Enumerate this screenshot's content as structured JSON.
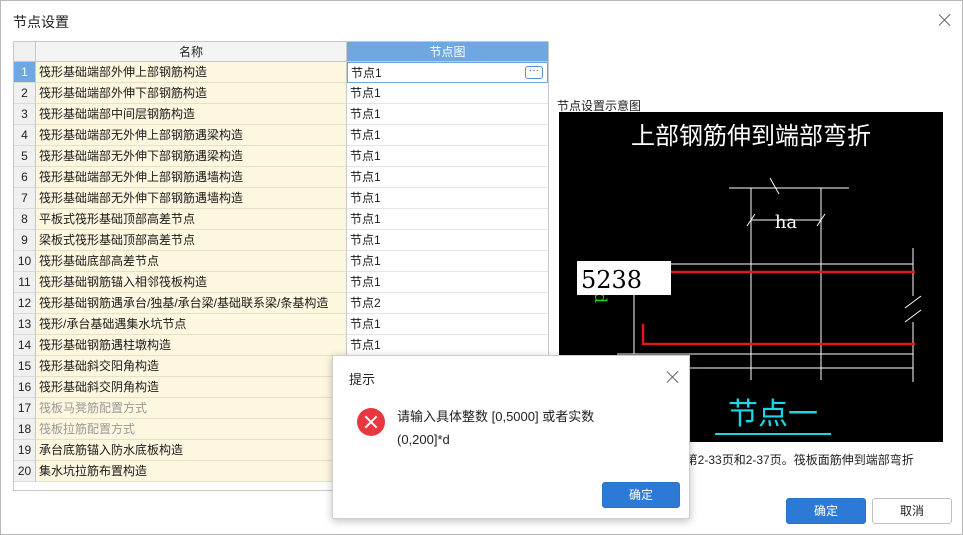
{
  "window": {
    "title": "节点设置"
  },
  "table": {
    "headers": {
      "name": "名称",
      "node": "节点图"
    },
    "rows": [
      {
        "num": "1",
        "name": "筏形基础端部外伸上部钢筋构造",
        "node": "节点1"
      },
      {
        "num": "2",
        "name": "筏形基础端部外伸下部钢筋构造",
        "node": "节点1"
      },
      {
        "num": "3",
        "name": "筏形基础端部中间层钢筋构造",
        "node": "节点1"
      },
      {
        "num": "4",
        "name": "筏形基础端部无外伸上部钢筋遇梁构造",
        "node": "节点1"
      },
      {
        "num": "5",
        "name": "筏形基础端部无外伸下部钢筋遇梁构造",
        "node": "节点1"
      },
      {
        "num": "6",
        "name": "筏形基础端部无外伸上部钢筋遇墙构造",
        "node": "节点1"
      },
      {
        "num": "7",
        "name": "筏形基础端部无外伸下部钢筋遇墙构造",
        "node": "节点1"
      },
      {
        "num": "8",
        "name": "平板式筏形基础顶部高差节点",
        "node": "节点1"
      },
      {
        "num": "9",
        "name": "梁板式筏形基础顶部高差节点",
        "node": "节点1"
      },
      {
        "num": "10",
        "name": "筏形基础底部高差节点",
        "node": "节点1"
      },
      {
        "num": "11",
        "name": "筏形基础钢筋锚入相邻筏板构造",
        "node": "节点1"
      },
      {
        "num": "12",
        "name": "筏形基础钢筋遇承台/独基/承台梁/基础联系梁/条基构造",
        "node": "节点2"
      },
      {
        "num": "13",
        "name": "筏形/承台基础遇集水坑节点",
        "node": "节点1"
      },
      {
        "num": "14",
        "name": "筏形基础钢筋遇柱墩构造",
        "node": "节点1"
      },
      {
        "num": "15",
        "name": "筏形基础斜交阳角构造",
        "node": ""
      },
      {
        "num": "16",
        "name": "筏形基础斜交阴角构造",
        "node": ""
      },
      {
        "num": "17",
        "name": "筏板马凳筋配置方式",
        "node": ""
      },
      {
        "num": "18",
        "name": "筏板拉筋配置方式",
        "node": ""
      },
      {
        "num": "19",
        "name": "承台底筋锚入防水底板构造",
        "node": ""
      },
      {
        "num": "20",
        "name": "集水坑拉筋布置构造",
        "node": ""
      }
    ]
  },
  "preview": {
    "label": "节点设置示意图",
    "heading": "上部钢筋伸到端部弯折",
    "dim_ha": "ha",
    "dim_side": "12d",
    "input_value": "5238",
    "node_label": "节点一",
    "caption": "3第2-33页和2-37页。筏板面筋伸到端部弯折"
  },
  "buttons": {
    "ok": "确定",
    "cancel": "取消"
  },
  "modal": {
    "title": "提示",
    "message_line1": "请输入具体整数 [0,5000] 或者实数",
    "message_line2": "(0,200]*d",
    "ok": "确定"
  }
}
